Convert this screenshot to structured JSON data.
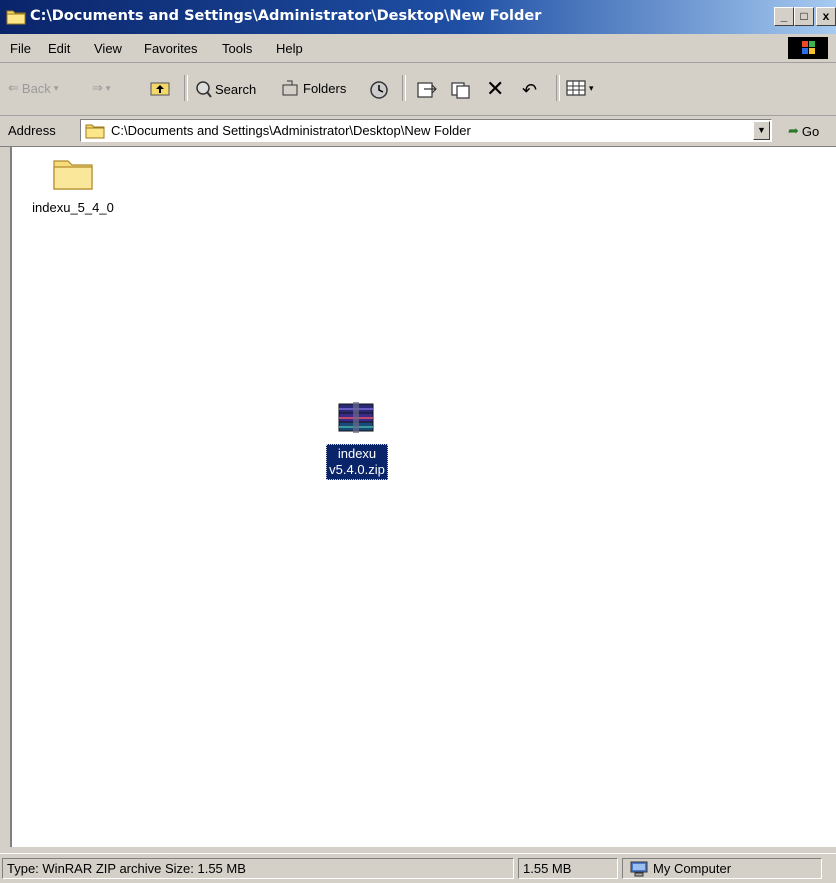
{
  "window": {
    "title": "C:\\Documents and Settings\\Administrator\\Desktop\\New Folder",
    "buttons": {
      "minimize": "_",
      "maximize": "□",
      "close": "x"
    }
  },
  "menu": {
    "items": [
      "File",
      "Edit",
      "View",
      "Favorites",
      "Tools",
      "Help"
    ]
  },
  "toolbar": {
    "back_label": "Back",
    "search_label": "Search",
    "folders_label": "Folders"
  },
  "address": {
    "label": "Address",
    "value": "C:\\Documents and Settings\\Administrator\\Desktop\\New Folder",
    "go_label": "Go"
  },
  "content": {
    "folder": {
      "name": "indexu_5_4_0"
    },
    "zip": {
      "name_line1": "indexu",
      "name_line2": "v5.4.0.zip"
    }
  },
  "status": {
    "info": "Type: WinRAR ZIP archive Size: 1.55 MB",
    "size": "1.55 MB",
    "zone": "My Computer"
  },
  "colors": {
    "title_start": "#0a246a",
    "title_end": "#a6caf0",
    "selection": "#0a246a",
    "chrome": "#d4d0c8"
  }
}
